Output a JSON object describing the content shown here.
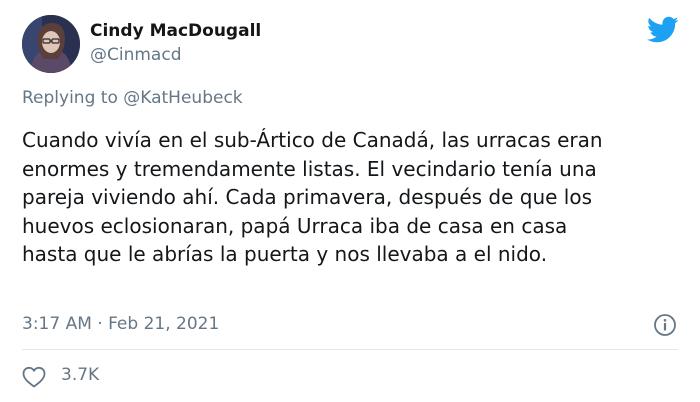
{
  "author": {
    "name": "Cindy MacDougall",
    "handle": "@Cinmacd"
  },
  "reply": {
    "prefix": "Replying to ",
    "mention": "@KatHeubeck"
  },
  "tweet": {
    "lines": [
      "Cuando vivía en el sub-Ártico de Canadá, las urracas eran",
      "enormes y tremendamente listas. El vecindario tenía una",
      "pareja viviendo ahí. Cada primavera, después de que los",
      "huevos eclosionaran, papá Urraca iba de casa en casa",
      "hasta que le abrías la puerta y nos llevaba a el nido."
    ],
    "timestamp": "3:17 AM · Feb 21, 2021",
    "likes": "3.7K"
  },
  "icons": {
    "logo": "twitter-bird-icon",
    "info": "info-icon",
    "like": "heart-icon"
  },
  "colors": {
    "brand": "#1da1f2",
    "text": "#14171a",
    "muted": "#657786",
    "divider": "#e1e8ed"
  }
}
